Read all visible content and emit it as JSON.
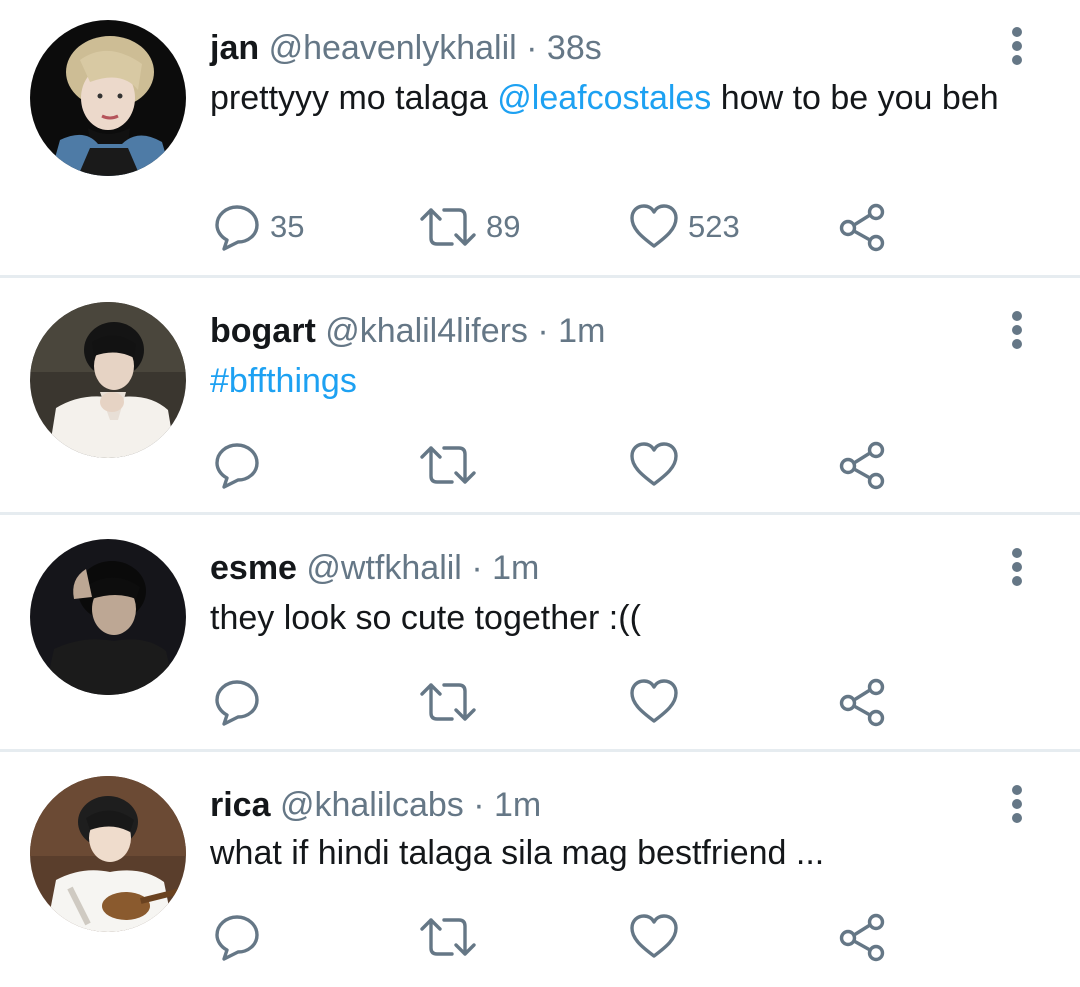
{
  "tweets": [
    {
      "name": "jan",
      "handle": "@heavenlykhalil",
      "sep": "·",
      "time": "38s",
      "text_parts": [
        "prettyyy mo talaga ",
        "@leafcostales",
        " how to be you beh"
      ],
      "replies": "35",
      "retweets": "89",
      "likes": "523",
      "avatar_bg": "#0c0c0c"
    },
    {
      "name": "bogart",
      "handle": "@khalil4lifers",
      "sep": "·",
      "time": "1m",
      "text_parts": [
        "#bffthings"
      ],
      "replies": "",
      "retweets": "",
      "likes": "",
      "avatar_bg": "#3a362f"
    },
    {
      "name": "esme",
      "handle": "@wtfkhalil",
      "sep": "·",
      "time": "1m",
      "text_parts": [
        "they look so cute together :(("
      ],
      "replies": "",
      "retweets": "",
      "likes": "",
      "avatar_bg": "#15151a"
    },
    {
      "name": "rica",
      "handle": "@khalilcabs",
      "sep": "·",
      "time": "1m",
      "text_parts": [
        "what if hindi talaga sila mag bestfriend ..."
      ],
      "replies": "",
      "retweets": "",
      "likes": "",
      "avatar_bg": "#5a3e2c"
    }
  ],
  "icons": {
    "reply": "reply-icon",
    "retweet": "retweet-icon",
    "like": "heart-icon",
    "share": "share-icon",
    "more": "more-vertical-icon"
  },
  "colors": {
    "link": "#1da1f2",
    "muted": "#657786",
    "text": "#14171a",
    "divider": "#e6ecf0"
  }
}
